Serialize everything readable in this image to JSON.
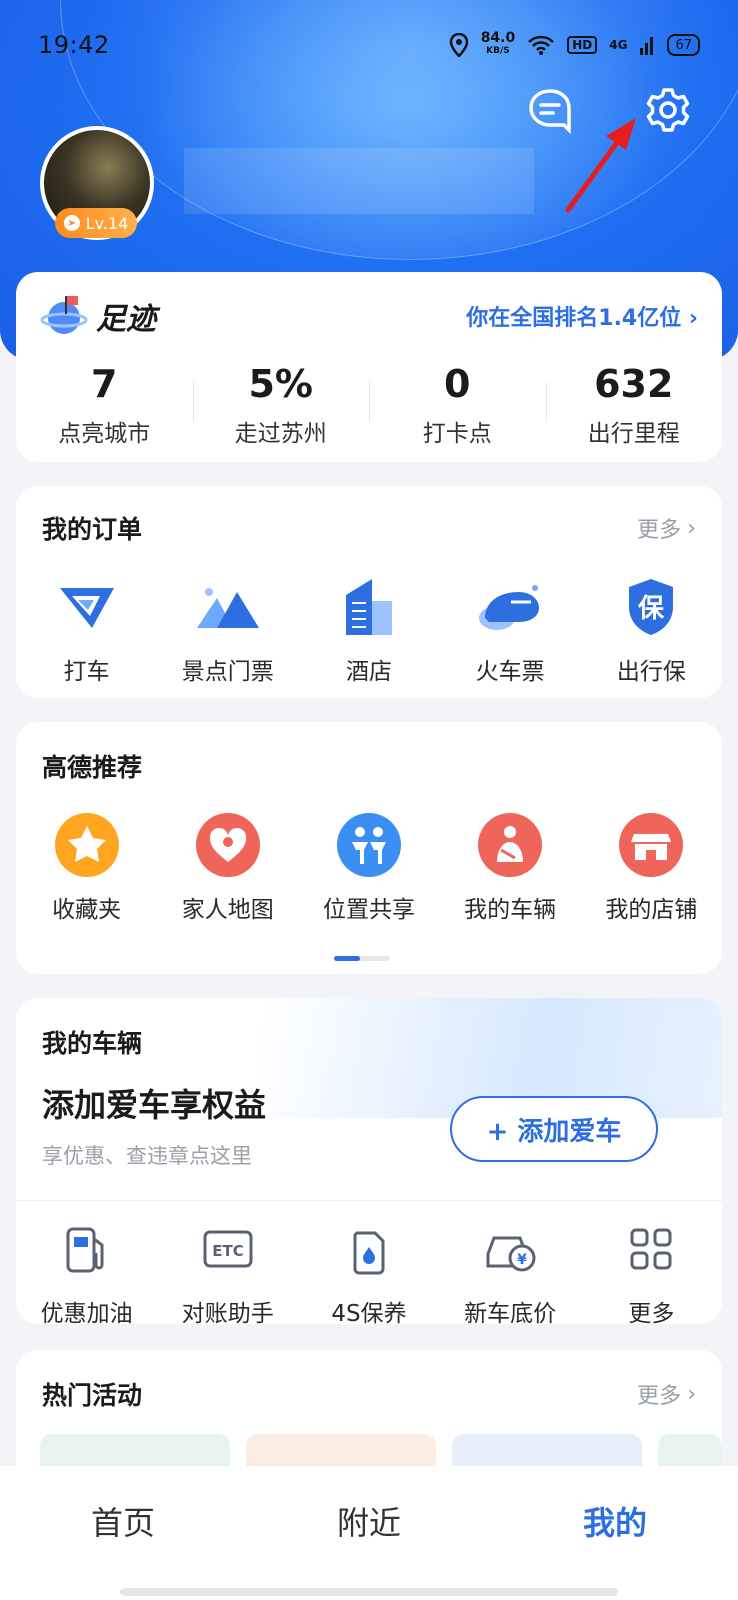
{
  "status": {
    "time": "19:42",
    "speed_value": "84.0",
    "speed_unit": "KB/S",
    "hd": "HD",
    "network": "4G",
    "battery": "67"
  },
  "profile": {
    "level": "Lv.14"
  },
  "footprint": {
    "title": "足迹",
    "rank": "你在全国排名1.4亿位",
    "stats": [
      {
        "value": "7",
        "label": "点亮城市"
      },
      {
        "value": "5%",
        "label": "走过苏州"
      },
      {
        "value": "0",
        "label": "打卡点"
      },
      {
        "value": "632",
        "label": "出行里程"
      }
    ]
  },
  "orders": {
    "title": "我的订单",
    "more": "更多",
    "items": [
      {
        "label": "打车",
        "icon": "taxi-icon"
      },
      {
        "label": "景点门票",
        "icon": "mountain-icon"
      },
      {
        "label": "酒店",
        "icon": "hotel-icon"
      },
      {
        "label": "火车票",
        "icon": "train-icon"
      },
      {
        "label": "出行保",
        "icon": "shield-icon"
      }
    ]
  },
  "recommend": {
    "title": "高德推荐",
    "items": [
      {
        "label": "收藏夹",
        "icon": "star-icon",
        "color": "#ffa51f"
      },
      {
        "label": "家人地图",
        "icon": "heart-icon",
        "color": "#f0655a"
      },
      {
        "label": "位置共享",
        "icon": "people-icon",
        "color": "#3b8ff2"
      },
      {
        "label": "我的车辆",
        "icon": "driver-icon",
        "color": "#f0655a"
      },
      {
        "label": "我的店铺",
        "icon": "store-icon",
        "color": "#f0655a"
      }
    ]
  },
  "vehicle": {
    "title": "我的车辆",
    "headline": "添加爱车享权益",
    "subtitle": "享优惠、查违章点这里",
    "add_button": "+ 添加爱车",
    "tools": [
      {
        "label": "优惠加油",
        "icon": "fuel-icon"
      },
      {
        "label": "对账助手",
        "icon": "etc-icon"
      },
      {
        "label": "4S保养",
        "icon": "oil-icon"
      },
      {
        "label": "新车底价",
        "icon": "car-price-icon"
      },
      {
        "label": "更多",
        "icon": "grid-icon"
      }
    ]
  },
  "hot": {
    "title": "热门活动",
    "more": "更多"
  },
  "tabs": [
    {
      "label": "首页"
    },
    {
      "label": "附近"
    },
    {
      "label": "我的"
    }
  ],
  "colors": {
    "accent": "#2d6fe0",
    "hero": "#1f6ff2"
  }
}
